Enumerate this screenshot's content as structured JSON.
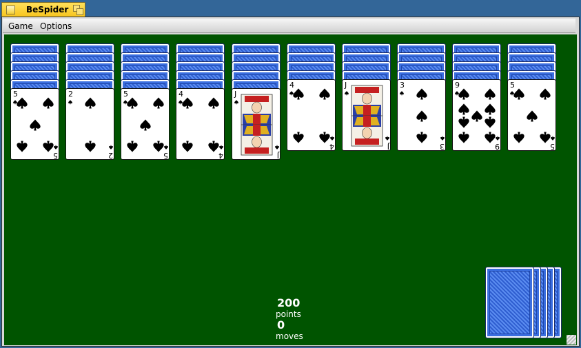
{
  "window": {
    "title": "BeSpider"
  },
  "menu": {
    "items": [
      "Game",
      "Options"
    ]
  },
  "columns": [
    {
      "hidden": 5,
      "top": {
        "rank": "5",
        "suit": "spade"
      }
    },
    {
      "hidden": 5,
      "top": {
        "rank": "2",
        "suit": "spade"
      }
    },
    {
      "hidden": 5,
      "top": {
        "rank": "5",
        "suit": "spade"
      }
    },
    {
      "hidden": 5,
      "top": {
        "rank": "4",
        "suit": "spade"
      }
    },
    {
      "hidden": 5,
      "top": {
        "rank": "J",
        "suit": "spade"
      }
    },
    {
      "hidden": 4,
      "top": {
        "rank": "4",
        "suit": "spade"
      }
    },
    {
      "hidden": 4,
      "top": {
        "rank": "J",
        "suit": "spade"
      }
    },
    {
      "hidden": 4,
      "top": {
        "rank": "3",
        "suit": "spade"
      }
    },
    {
      "hidden": 4,
      "top": {
        "rank": "9",
        "suit": "spade"
      }
    },
    {
      "hidden": 4,
      "top": {
        "rank": "5",
        "suit": "spade"
      }
    }
  ],
  "stock": {
    "deals_remaining": 5
  },
  "score": {
    "points": "200",
    "points_label": "points",
    "moves": "0",
    "moves_label": "moves"
  },
  "colors": {
    "table": "#005400",
    "card_back": "#3a6ee0",
    "title_tab": "#f7c51f"
  }
}
